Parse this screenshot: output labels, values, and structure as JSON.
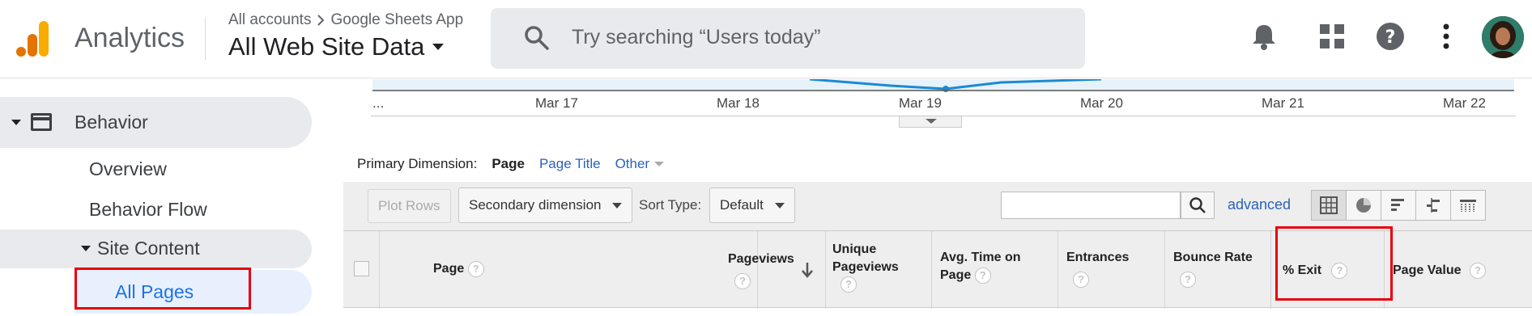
{
  "header": {
    "brand": "Analytics",
    "breadcrumb": {
      "account": "All accounts",
      "property": "Google Sheets App"
    },
    "view": "All Web Site Data",
    "search_placeholder": "Try searching “Users today”"
  },
  "sidebar": {
    "section": "Behavior",
    "items": [
      "Overview",
      "Behavior Flow"
    ],
    "subsection": "Site Content",
    "active_item": "All Pages"
  },
  "chart": {
    "dates": [
      "...",
      "Mar 17",
      "Mar 18",
      "Mar 19",
      "Mar 20",
      "Mar 21",
      "Mar 22"
    ]
  },
  "primary_dimension": {
    "label": "Primary Dimension:",
    "options": [
      "Page",
      "Page Title",
      "Other"
    ]
  },
  "toolbar": {
    "plot_rows": "Plot Rows",
    "secondary_dimension": "Secondary dimension",
    "sort_type_label": "Sort Type:",
    "sort_type_value": "Default",
    "advanced": "advanced"
  },
  "table": {
    "columns": [
      {
        "label": "Page"
      },
      {
        "label": "Pageviews"
      },
      {
        "label": "Unique Pageviews"
      },
      {
        "label": "Avg. Time on Page"
      },
      {
        "label": "Entrances"
      },
      {
        "label": "Bounce Rate"
      },
      {
        "label": "% Exit"
      },
      {
        "label": "Page Value"
      }
    ]
  },
  "colors": {
    "accent": "#1a73e8",
    "highlight": "#e8000b",
    "link": "#2a62bc",
    "chart_line": "#1a8bd3"
  }
}
